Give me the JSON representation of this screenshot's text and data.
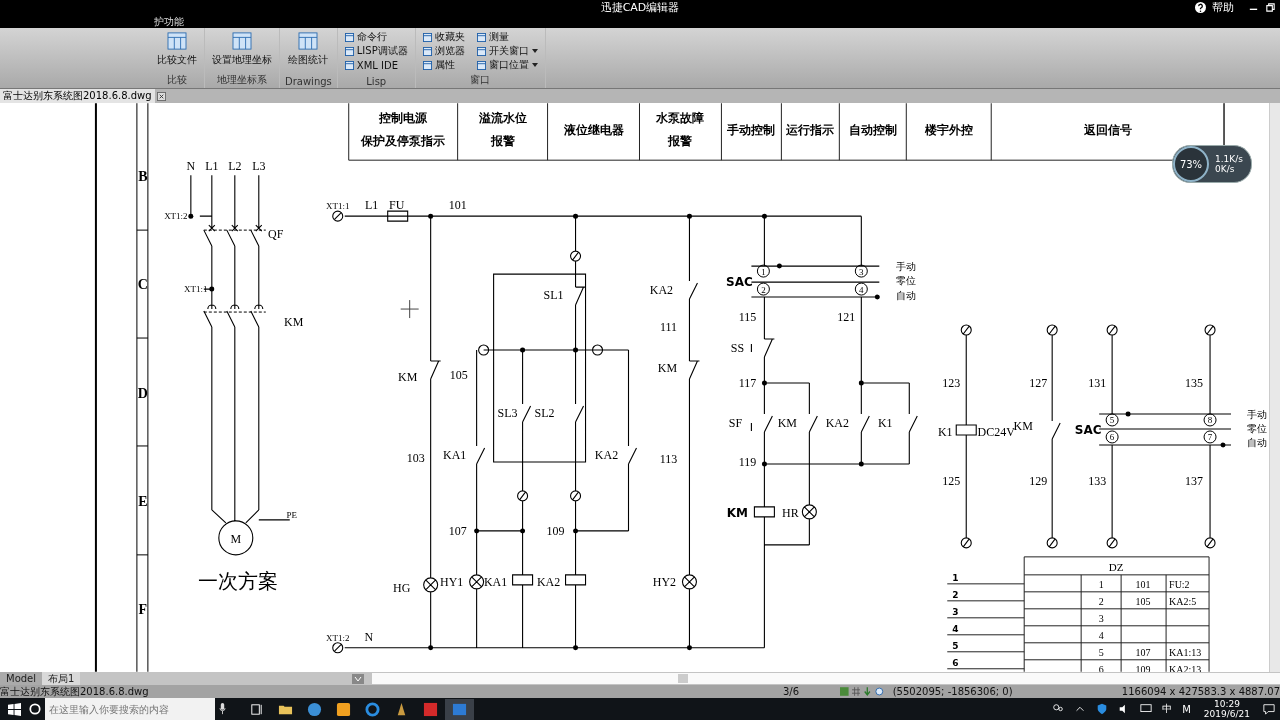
{
  "window": {
    "title": "迅捷CAD编辑器",
    "help": "帮助"
  },
  "menu_tabs": [
    {
      "label": "护功能",
      "selected": false
    }
  ],
  "ribbon": {
    "groups": [
      {
        "label": "比较",
        "tools": [
          {
            "label": "比较文件",
            "kind": "large",
            "has_menu": false
          }
        ]
      },
      {
        "label": "地理坐标系",
        "tools": [
          {
            "label": "设置地理坐标",
            "kind": "large",
            "has_menu": false
          }
        ]
      },
      {
        "label": "Drawings",
        "tools": [
          {
            "label": "绘图统计",
            "kind": "large",
            "has_menu": false
          }
        ]
      },
      {
        "label": "Lisp",
        "tools": [
          {
            "label": "命令行",
            "kind": "small",
            "has_menu": false
          },
          {
            "label": "LISP调试器",
            "kind": "small",
            "has_menu": false
          },
          {
            "label": "XML IDE",
            "kind": "small",
            "has_menu": false
          }
        ]
      },
      {
        "label": "窗口",
        "tools": [
          {
            "label": "收藏夹",
            "kind": "small",
            "has_menu": false
          },
          {
            "label": "浏览器",
            "kind": "small",
            "has_menu": false
          },
          {
            "label": "属性",
            "kind": "small",
            "has_menu": false
          },
          {
            "label": "测量",
            "kind": "small",
            "has_menu": false
          },
          {
            "label": "开关窗口",
            "kind": "small",
            "has_menu": true
          },
          {
            "label": "窗口位置",
            "kind": "small",
            "has_menu": true
          }
        ]
      }
    ]
  },
  "document_tabs": [
    {
      "label": "富士达别东系统图2018.6.8.dwg",
      "selected": true
    }
  ],
  "drawing": {
    "header_cells": [
      {
        "lines": [
          "控制电源",
          "保护及停泵指示"
        ]
      },
      {
        "lines": [
          "溢流水位",
          "报警"
        ]
      },
      {
        "lines": [
          "液位继电器"
        ]
      },
      {
        "lines": [
          "水泵故障",
          "报警"
        ]
      },
      {
        "lines": [
          "手动控制"
        ]
      },
      {
        "lines": [
          "运行指示"
        ]
      },
      {
        "lines": [
          "自动控制"
        ]
      },
      {
        "lines": [
          "楼宇外控"
        ]
      },
      {
        "lines": [
          "返回信号"
        ]
      }
    ],
    "row_markers": [
      "B",
      "C",
      "D",
      "E",
      "F"
    ],
    "circuits": [
      {
        "labels": [
          {
            "text": "N",
            "kind": "plain"
          },
          {
            "text": "L1",
            "kind": "plain"
          },
          {
            "text": "L2",
            "kind": "plain"
          },
          {
            "text": "L3",
            "kind": "plain"
          },
          {
            "text": "XT1:2",
            "kind": "small"
          },
          {
            "text": "QF",
            "kind": "plain"
          },
          {
            "text": "XT1:1",
            "kind": "small"
          },
          {
            "text": "KM",
            "kind": "plain"
          },
          {
            "text": "PE",
            "kind": "small"
          },
          {
            "text": "M",
            "kind": "plain"
          },
          {
            "text": "一次方案",
            "kind": "title"
          }
        ]
      },
      {
        "labels": [
          {
            "text": "XT1:1",
            "kind": "small"
          },
          {
            "text": "L1",
            "kind": "plain"
          },
          {
            "text": "FU",
            "kind": "plain"
          },
          {
            "text": "101",
            "kind": "plain"
          },
          {
            "text": "SL1",
            "kind": "plain"
          },
          {
            "text": "KA2",
            "kind": "plain"
          },
          {
            "text": "111",
            "kind": "plain"
          },
          {
            "text": "KM",
            "kind": "plain"
          },
          {
            "text": "105",
            "kind": "plain"
          },
          {
            "text": "KM",
            "kind": "plain"
          },
          {
            "text": "SL3",
            "kind": "plain"
          },
          {
            "text": "SL2",
            "kind": "plain"
          },
          {
            "text": "103",
            "kind": "plain"
          },
          {
            "text": "KA1",
            "kind": "plain"
          },
          {
            "text": "KA2",
            "kind": "plain"
          },
          {
            "text": "113",
            "kind": "plain"
          },
          {
            "text": "107",
            "kind": "plain"
          },
          {
            "text": "109",
            "kind": "plain"
          },
          {
            "text": "HG",
            "kind": "plain"
          },
          {
            "text": "HY1",
            "kind": "plain"
          },
          {
            "text": "KA1",
            "kind": "plain"
          },
          {
            "text": "KA2",
            "kind": "plain"
          },
          {
            "text": "HY2",
            "kind": "plain"
          },
          {
            "text": "XT1:2",
            "kind": "small"
          },
          {
            "text": "N",
            "kind": "plain"
          }
        ]
      },
      {
        "labels": [
          {
            "text": "1",
            "kind": "circled"
          },
          {
            "text": "3",
            "kind": "circled"
          },
          {
            "text": "手动",
            "kind": "note"
          },
          {
            "text": "SAC",
            "kind": "bold"
          },
          {
            "text": "2",
            "kind": "circled"
          },
          {
            "text": "4",
            "kind": "circled"
          },
          {
            "text": "零位",
            "kind": "note"
          },
          {
            "text": "自动",
            "kind": "note"
          },
          {
            "text": "115",
            "kind": "plain"
          },
          {
            "text": "121",
            "kind": "plain"
          },
          {
            "text": "SS",
            "kind": "plain"
          },
          {
            "text": "117",
            "kind": "plain"
          },
          {
            "text": "SF",
            "kind": "plain"
          },
          {
            "text": "KM",
            "kind": "plain"
          },
          {
            "text": "KA2",
            "kind": "plain"
          },
          {
            "text": "K1",
            "kind": "plain"
          },
          {
            "text": "119",
            "kind": "plain"
          },
          {
            "text": "KM",
            "kind": "bold"
          },
          {
            "text": "HR",
            "kind": "plain"
          }
        ]
      },
      {
        "labels": [
          {
            "text": "123",
            "kind": "plain"
          },
          {
            "text": "127",
            "kind": "plain"
          },
          {
            "text": "131",
            "kind": "plain"
          },
          {
            "text": "135",
            "kind": "plain"
          },
          {
            "text": "5",
            "kind": "circled"
          },
          {
            "text": "8",
            "kind": "circled"
          },
          {
            "text": "手动",
            "kind": "note"
          },
          {
            "text": "KM",
            "kind": "plain"
          },
          {
            "text": "K1",
            "kind": "plain"
          },
          {
            "text": "DC24V",
            "kind": "plain"
          },
          {
            "text": "SAC",
            "kind": "bold"
          },
          {
            "text": "6",
            "kind": "circled"
          },
          {
            "text": "7",
            "kind": "circled"
          },
          {
            "text": "零位",
            "kind": "note"
          },
          {
            "text": "自动",
            "kind": "note"
          },
          {
            "text": "125",
            "kind": "plain"
          },
          {
            "text": "129",
            "kind": "plain"
          },
          {
            "text": "133",
            "kind": "plain"
          },
          {
            "text": "137",
            "kind": "plain"
          }
        ]
      }
    ],
    "terminal_table": {
      "title": "DZ",
      "row_numbers": [
        "1",
        "2",
        "3",
        "4",
        "5",
        "6"
      ],
      "rows": [
        {
          "cells": [
            "1",
            "101",
            "FU:2"
          ]
        },
        {
          "cells": [
            "2",
            "105",
            "KA2:5"
          ]
        },
        {
          "cells": [
            "3"
          ]
        },
        {
          "cells": [
            "4"
          ]
        },
        {
          "cells": [
            "5",
            "107",
            "KA1:13"
          ]
        },
        {
          "cells": [
            "6",
            "109",
            "KA2:13"
          ]
        }
      ]
    }
  },
  "network_widget": {
    "percent": "73%",
    "upload": "1.1K/s",
    "download": "0K/s"
  },
  "layout_tabs": [
    {
      "label": "Model",
      "selected": false
    },
    {
      "label": "布局1",
      "selected": true
    }
  ],
  "status_bar": {
    "file": "富士达别东系统图2018.6.8.dwg",
    "page": "3/6",
    "coordinates": "(5502095; -1856306; 0)",
    "extents": "1166094 x 427583.3 x 4887.07"
  },
  "taskbar": {
    "search_placeholder": "在这里输入你要搜索的内容",
    "ime": "中",
    "ime_mode": "M",
    "time": "10:29",
    "date": "2019/6/21"
  }
}
